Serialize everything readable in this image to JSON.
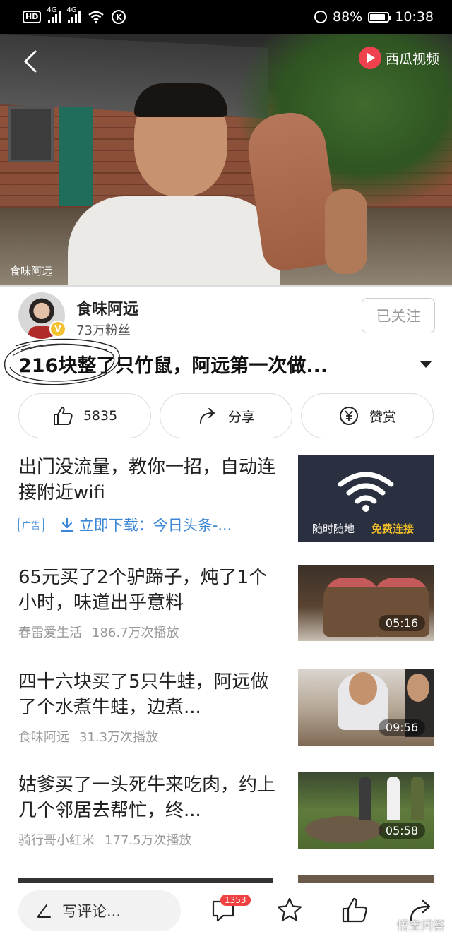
{
  "status_bar": {
    "hd": "HD",
    "net1": "4G",
    "net2": "4G",
    "k": "K",
    "battery": "88%",
    "battery_level": 0.88,
    "time": "10:38"
  },
  "video": {
    "brand": "西瓜视频",
    "watermark": "食味阿远"
  },
  "author": {
    "name": "食味阿远",
    "fans": "73万粉丝",
    "verified_badge": "V",
    "follow_label": "已关注"
  },
  "title": "216块整了只竹鼠，阿远第一次做...",
  "actions": {
    "like_count": "5835",
    "share_label": "分享",
    "reward_label": "赞赏"
  },
  "feed": [
    {
      "title": "出门没流量，教你一招，自动连接附近wifi",
      "ad_tag": "广告",
      "ad_link": "立即下载：今日头条-...",
      "thumb_caption_left": "随时随地",
      "thumb_caption_right": "免费连接"
    },
    {
      "title": "65元买了2个驴蹄子，炖了1个小时，味道出乎意料",
      "source": "春雷爱生活",
      "plays": "186.7万次播放",
      "duration": "05:16"
    },
    {
      "title": "四十六块买了5只牛蛙，阿远做了个水煮牛蛙，边煮...",
      "source": "食味阿远",
      "plays": "31.3万次播放",
      "duration": "09:56"
    },
    {
      "title": "姑爹买了一头死牛来吃肉，约上几个邻居去帮忙，终...",
      "source": "骑行哥小红米",
      "plays": "177.5万次播放",
      "duration": "05:58"
    }
  ],
  "bottom_bar": {
    "comment_placeholder": "写评论...",
    "comment_count": "1353",
    "watermark": "悟空问答"
  },
  "colors": {
    "accent_blue": "#3b87d6",
    "badge_red": "#f04142",
    "verified_gold": "#f4c133",
    "xigua_red": "#f0424e"
  }
}
